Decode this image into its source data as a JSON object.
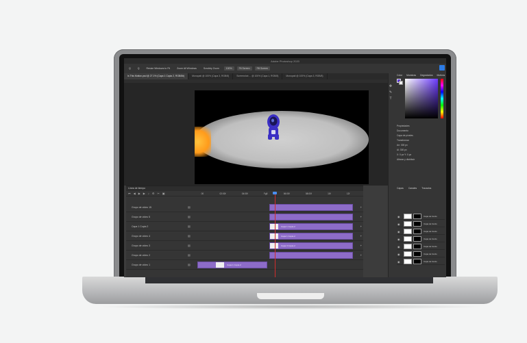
{
  "app": {
    "window_title": "Adobe Photoshop 2020",
    "accent_color": "#2c7be5",
    "clip_color": "#8d6cc8"
  },
  "options_bar": {
    "items": [
      "Q",
      "Q",
      "Resize Windows to Fit",
      "Zoom All Windows",
      "Scrubby Zoom",
      "100%",
      "Fit Screen",
      "Fill Screen"
    ]
  },
  "document_tabs": [
    {
      "label": "Is This Motion.psd @ 27.1% (Capa 1 Copia 2, RGB/8#)",
      "active": true
    },
    {
      "label": "Monopati @ 100% (Capa 3, RGB/8)",
      "active": false
    },
    {
      "label": "Screenshot ... @ 100% (Capa 1, RGB/8)",
      "active": false
    },
    {
      "label": "Monopati @ 100% (Capa 3, RGB/8)",
      "active": false
    }
  ],
  "timeline": {
    "panel_title": "Línea de tiempo",
    "time_marks": [
      "00",
      "02:00f",
      "04:00f",
      "Fg5",
      "06:00f",
      "08:00f",
      "10f",
      "12f"
    ],
    "tracks": [
      {
        "label": "Grupo de vídeo 15"
      },
      {
        "label": "Grupo de vídeo 5"
      },
      {
        "label": "Capa 1 Copia 2"
      },
      {
        "label": "Grupo de vídeo 4"
      },
      {
        "label": "Grupo de vídeo 3"
      },
      {
        "label": "Grupo de vídeo 2"
      },
      {
        "label": "Grupo de vídeo 1"
      }
    ],
    "clip_labels": [
      "Capa 1 Copia 2",
      "Capa 1 Copia 2",
      "Capa 3 Copia 2",
      "Capa 1 Copia 2"
    ]
  },
  "right_panel": {
    "tabs": [
      "Color",
      "Muestras",
      "Degradados",
      "Motivos"
    ],
    "properties_title": "Propiedades",
    "properties_lines": [
      "Documento",
      "Capa de píxeles",
      "Transformar",
      "An: 300 px",
      "Al: 300 px",
      "X: 0 px  Y: 0 px",
      "Alinear y distribuir"
    ],
    "layers_tabs": [
      "Capas",
      "Canales",
      "Trazados"
    ],
    "layers": [
      {
        "name": "Capa de fondo"
      },
      {
        "name": "Capa de fondo"
      },
      {
        "name": "Capa de fondo"
      },
      {
        "name": "Capa de fondo"
      },
      {
        "name": "Capa de fondo"
      },
      {
        "name": "Capa de fondo"
      },
      {
        "name": "Capa de fondo"
      }
    ]
  },
  "icons": [
    "zoom-icon",
    "play-icon",
    "eye-icon",
    "brush-icon",
    "move-icon",
    "lock-icon"
  ]
}
